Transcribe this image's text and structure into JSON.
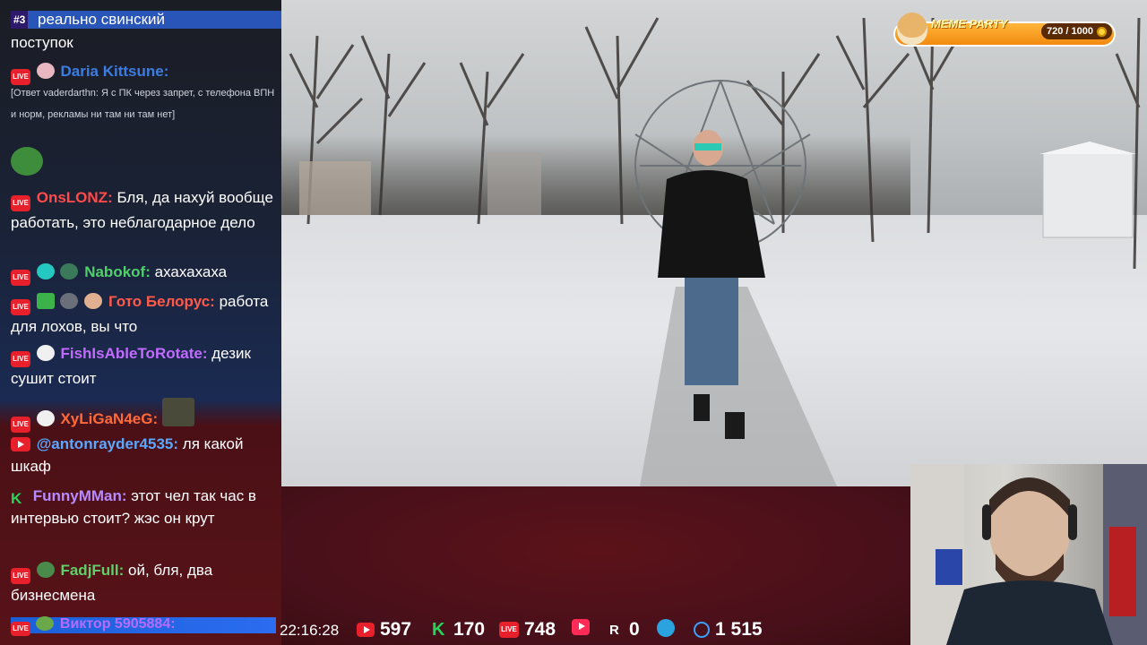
{
  "meme_party": {
    "title": "MEME PARTY",
    "count": "720 / 1000"
  },
  "chat": {
    "highlight": {
      "rank": "#3",
      "text": "реально свинский"
    },
    "messages": [
      {
        "text": "поступок"
      },
      {
        "user": "Daria Kittsune:",
        "user_color": "#3d7de0"
      },
      {
        "text": "[Ответ vaderdarthn: Я с ПК через запрет, с телефона ВПН и норм, рекламы ни там ни там нет]"
      },
      {
        "user": "OnsLONZ:",
        "user_color": "#ff4a4a",
        "text": "Бля, да нахуй вообще работать, это неблагодарное дело"
      },
      {
        "user": "Nabokof:",
        "user_color": "#4fd06a",
        "text": "ахахахаха"
      },
      {
        "user": "Гото Белорус:",
        "user_color": "#ff5a4a",
        "text": "работа для лохов, вы что"
      },
      {
        "user": "FishIsAbleToRotate:",
        "user_color": "#c26bff",
        "text": "дезик сушит стоит"
      },
      {
        "user": "XyLiGaN4eG:",
        "user_color": "#ff6a3a"
      },
      {
        "user": "@antonrayder4535:",
        "user_color": "#5aa8ff",
        "text": "ля какой шкаф"
      },
      {
        "user": "FunnyMMan:",
        "user_color": "#b78aff",
        "text": "этот чел так час в интервью стоит? жэс он крут"
      },
      {
        "user": "FadjFull:",
        "user_color": "#5fd06a",
        "text": "ой, бля, два бизнесмена"
      },
      {
        "user": "Виктор 5905884:",
        "user_color": "#b86bff"
      }
    ]
  },
  "status_bar": {
    "time": "22:16:28",
    "youtube_viewers": "597",
    "kick_viewers": "170",
    "vk_live_viewers": "748",
    "rutube_viewers": "0",
    "total_viewers": "1 515",
    "live_badge_text": "LIVE"
  },
  "colors": {
    "live_red": "#e8202b",
    "kick_green": "#27d35b",
    "accent_blue": "#2b6cf0"
  }
}
